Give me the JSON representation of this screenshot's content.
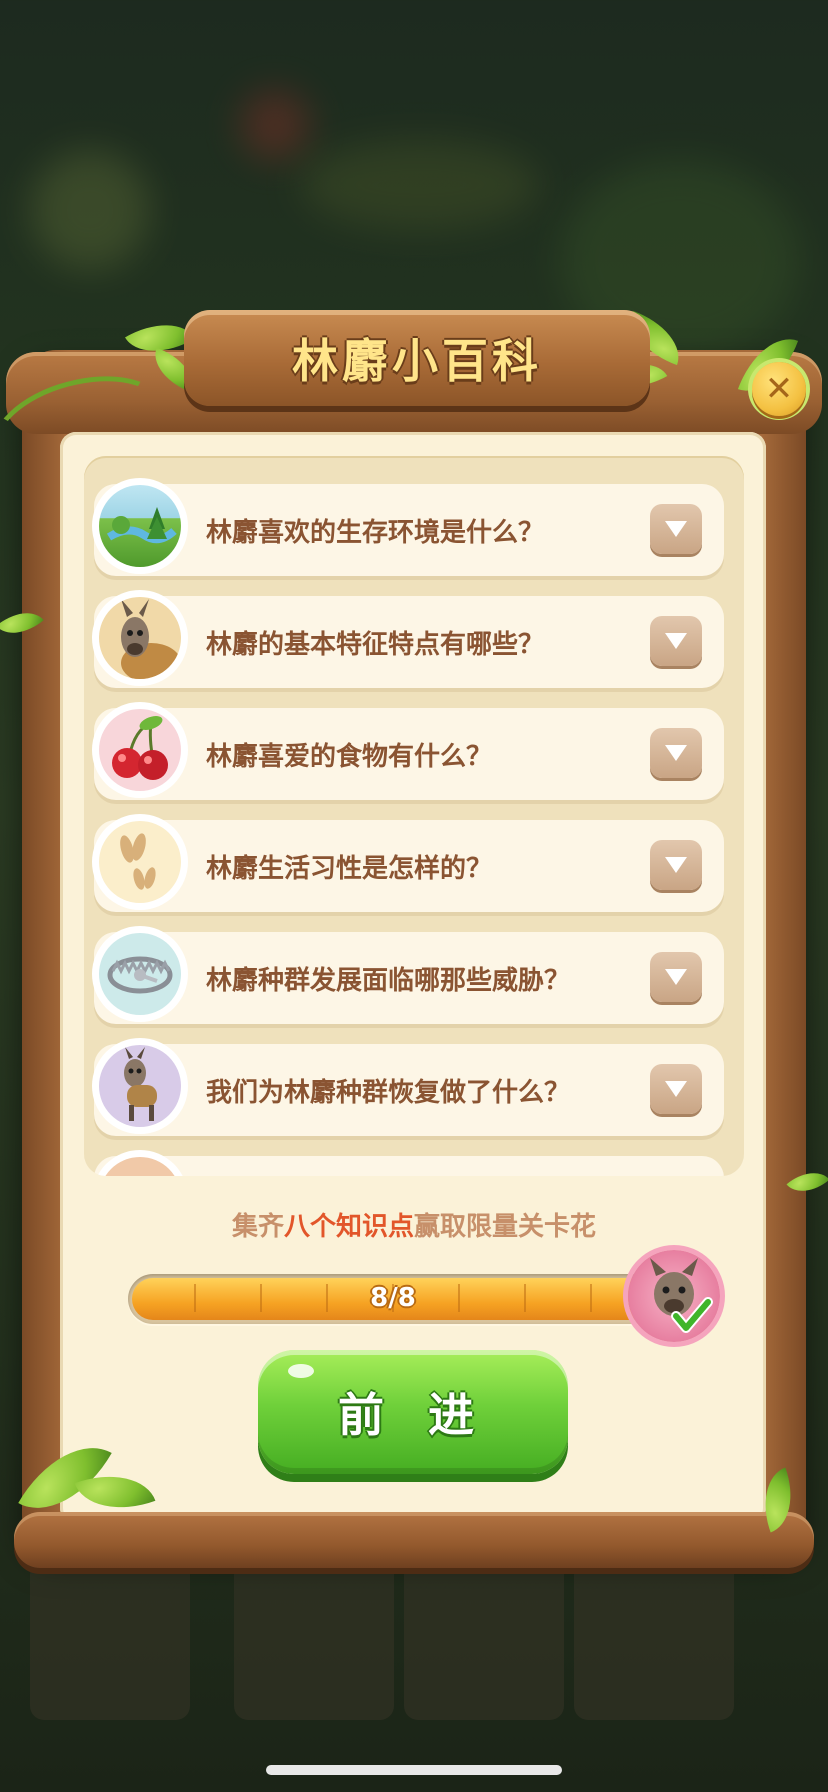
{
  "panel": {
    "title": "林麝小百科",
    "close_icon": "close-icon"
  },
  "questions": [
    {
      "label": "林麝喜欢的生存环境是什么？",
      "icon": "landscape-icon"
    },
    {
      "label": "林麝的基本特征特点有哪些？",
      "icon": "musk-deer-icon"
    },
    {
      "label": "林麝喜爱的食物有什么？",
      "icon": "cherry-icon"
    },
    {
      "label": "林麝生活习性是怎样的？",
      "icon": "hoofprint-icon"
    },
    {
      "label": "林麝种群发展面临哪那些威胁？",
      "icon": "trap-icon"
    },
    {
      "label": "我们为林麝种群恢复做了什么？",
      "icon": "deer-icon"
    }
  ],
  "reward": {
    "prefix": "集齐",
    "highlight": "八个知识点",
    "suffix": "赢取限量关卡花"
  },
  "progress": {
    "label": "8/8",
    "current": 8,
    "total": 8
  },
  "actions": {
    "forward_label": "前 进"
  },
  "colors": {
    "wood": "#9a6032",
    "parchment": "#fbf2d8",
    "question_text": "#8a5432",
    "highlight": "#e2562a",
    "progress_fill": "#f6a323",
    "button_green": "#6fd03a"
  }
}
